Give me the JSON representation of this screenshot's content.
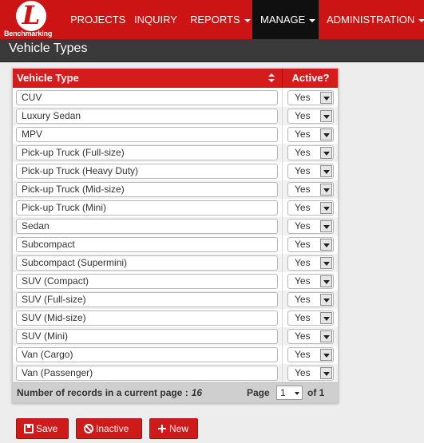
{
  "nav": {
    "logo_letter": "L",
    "brand": "Benchmarking",
    "items": [
      {
        "label": "PROJECTS"
      },
      {
        "label": "INQUIRY"
      },
      {
        "label": "REPORTS"
      },
      {
        "label": "MANAGE"
      },
      {
        "label": "ADMINISTRATION"
      }
    ]
  },
  "page": {
    "title": "Vehicle Types"
  },
  "grid": {
    "columns": {
      "type": "Vehicle Type",
      "active": "Active?"
    },
    "rows": [
      {
        "type": "CUV",
        "active": "Yes"
      },
      {
        "type": "Luxury Sedan",
        "active": "Yes"
      },
      {
        "type": "MPV",
        "active": "Yes"
      },
      {
        "type": "Pick-up Truck (Full-size)",
        "active": "Yes"
      },
      {
        "type": "Pick-up Truck (Heavy Duty)",
        "active": "Yes"
      },
      {
        "type": "Pick-up Truck (Mid-size)",
        "active": "Yes"
      },
      {
        "type": "Pick-up Truck (Mini)",
        "active": "Yes"
      },
      {
        "type": "Sedan",
        "active": "Yes"
      },
      {
        "type": "Subcompact",
        "active": "Yes"
      },
      {
        "type": "Subcompact (Supermini)",
        "active": "Yes"
      },
      {
        "type": "SUV (Compact)",
        "active": "Yes"
      },
      {
        "type": "SUV (Full-size)",
        "active": "Yes"
      },
      {
        "type": "SUV (Mid-size)",
        "active": "Yes"
      },
      {
        "type": "SUV (Mini)",
        "active": "Yes"
      },
      {
        "type": "Van (Cargo)",
        "active": "Yes"
      },
      {
        "type": "Van (Passenger)",
        "active": "Yes"
      }
    ],
    "footer": {
      "records_label": "Number of records in a current page :",
      "records_count": "16",
      "page_label": "Page",
      "page_value": "1",
      "of_label": "of 1"
    }
  },
  "actions": {
    "save": "Save",
    "inactive": "Inactive",
    "new": "New"
  },
  "colors": {
    "brand_red": "#cc1414",
    "nav_active": "#101010",
    "titlebar": "#3a3a3a"
  }
}
